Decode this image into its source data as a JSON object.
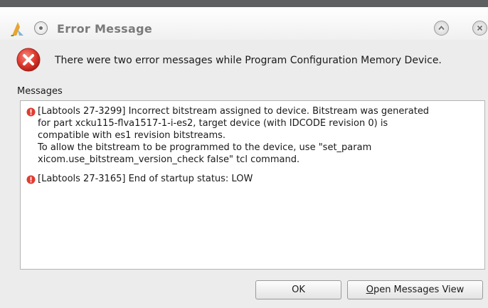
{
  "window": {
    "title": "Error Message"
  },
  "summary": {
    "text": "There were two error messages while Program Configuration Memory Device."
  },
  "messages": {
    "label": "Messages",
    "items": [
      {
        "lines": [
          "[Labtools 27-3299] Incorrect bitstream assigned to device. Bitstream was generated",
          "for part xcku115-flva1517-1-i-es2, target device (with IDCODE revision 0) is",
          "compatible with es1 revision bitstreams.",
          "To allow the bitstream to be programmed to the device, use \"set_param",
          "xicom.use_bitstream_version_check false\" tcl command."
        ]
      },
      {
        "lines": [
          "[Labtools 27-3165] End of startup status: LOW"
        ]
      }
    ]
  },
  "buttons": {
    "ok_label": "OK",
    "open_mnemonic": "O",
    "open_rest": "pen Messages View"
  },
  "colors": {
    "error_red": "#e03c31",
    "title_gray": "#7a7a7a"
  },
  "icons": {
    "app": "vivado-logo-icon",
    "menu": "window-menu-icon",
    "maximize": "maximize-icon",
    "close": "close-icon",
    "error": "error-icon"
  }
}
